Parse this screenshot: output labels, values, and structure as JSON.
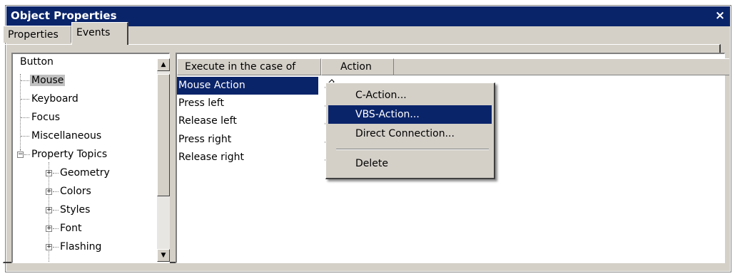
{
  "window": {
    "title": "Object Properties",
    "close_glyph": "×"
  },
  "tabs": [
    {
      "label": "Properties",
      "active": false
    },
    {
      "label": "Events",
      "active": true
    }
  ],
  "tree": {
    "items": [
      {
        "label": "Button"
      },
      {
        "label": "Mouse",
        "selected": true
      },
      {
        "label": "Keyboard"
      },
      {
        "label": "Focus"
      },
      {
        "label": "Miscellaneous"
      },
      {
        "label": "Property Topics",
        "expander": "−"
      },
      {
        "label": "Geometry",
        "expander": "+"
      },
      {
        "label": "Colors",
        "expander": "+"
      },
      {
        "label": "Styles",
        "expander": "+"
      },
      {
        "label": "Font",
        "expander": "+"
      },
      {
        "label": "Flashing",
        "expander": "+"
      }
    ],
    "scroll_up": "▲",
    "scroll_down": "▼"
  },
  "grid": {
    "headers": [
      "Execute in the case of",
      "Action"
    ],
    "rows": [
      {
        "event": "Mouse Action",
        "selected": true
      },
      {
        "event": "Press left"
      },
      {
        "event": "Release left"
      },
      {
        "event": "Press right"
      },
      {
        "event": "Release right"
      }
    ],
    "action_icon": "pencil-icon"
  },
  "context_menu": {
    "items": [
      {
        "label": "C-Action..."
      },
      {
        "label": "VBS-Action...",
        "highlighted": true
      },
      {
        "label": "Direct Connection..."
      },
      {
        "label": "Delete"
      }
    ]
  },
  "colors": {
    "titlebar": "#0a246a",
    "face": "#d4d0c8",
    "selection": "#0a246a"
  }
}
